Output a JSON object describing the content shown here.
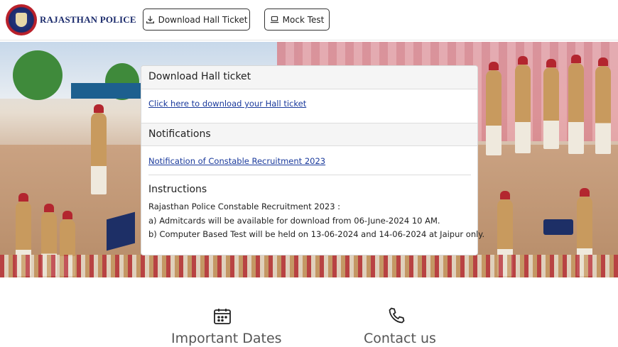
{
  "header": {
    "brand": "RAJASTHAN POLICE",
    "buttons": {
      "hall_ticket": "Download Hall Ticket",
      "mock_test": "Mock Test"
    },
    "icons": {
      "hall_ticket": "download-icon",
      "mock_test": "laptop-icon"
    }
  },
  "panel": {
    "hall_ticket": {
      "title": "Download Hall ticket",
      "link": "Click here to download your Hall ticket"
    },
    "notifications": {
      "title": "Notifications",
      "link": "Notification of Constable Recruitment 2023"
    },
    "instructions": {
      "title": "Instructions",
      "lines": [
        "Rajasthan Police Constable Recruitment 2023 :",
        "a) Admitcards will be available for download from 06-June-2024 10 AM.",
        "b) Computer Based Test will be held on 13-06-2024 and 14-06-2024 at Jaipur only."
      ]
    }
  },
  "bottom": {
    "important_dates": "Important Dates",
    "contact_us": "Contact us",
    "icons": {
      "important_dates": "calendar-icon",
      "contact_us": "phone-icon"
    }
  },
  "colors": {
    "brand": "#1a2a6b",
    "link": "#1a3a9c",
    "panel_header_bg": "#f5f5f5"
  }
}
